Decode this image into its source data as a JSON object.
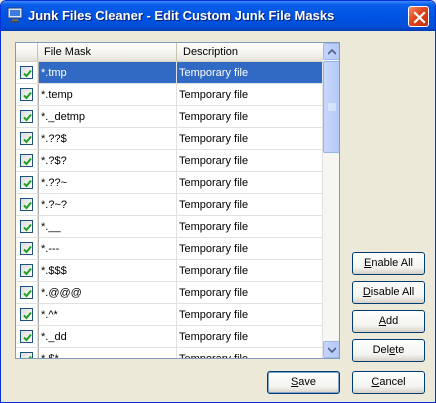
{
  "window": {
    "title": "Junk Files Cleaner - Edit Custom Junk File Masks"
  },
  "grid": {
    "columns": [
      "File Mask",
      "Description"
    ],
    "rows": [
      {
        "checked": true,
        "mask": "*.tmp",
        "description": "Temporary file",
        "selected": true
      },
      {
        "checked": true,
        "mask": "*.temp",
        "description": "Temporary file"
      },
      {
        "checked": true,
        "mask": "*._detmp",
        "description": "Temporary file"
      },
      {
        "checked": true,
        "mask": "*.??$",
        "description": "Temporary file"
      },
      {
        "checked": true,
        "mask": "*.?$?",
        "description": "Temporary file"
      },
      {
        "checked": true,
        "mask": "*.??~",
        "description": "Temporary file"
      },
      {
        "checked": true,
        "mask": "*.?~?",
        "description": "Temporary file"
      },
      {
        "checked": true,
        "mask": "*.__",
        "description": "Temporary file"
      },
      {
        "checked": true,
        "mask": "*.---",
        "description": "Temporary file"
      },
      {
        "checked": true,
        "mask": "*.$$$",
        "description": "Temporary file"
      },
      {
        "checked": true,
        "mask": "*.@@@",
        "description": "Temporary file"
      },
      {
        "checked": true,
        "mask": "*.^*",
        "description": "Temporary file"
      },
      {
        "checked": true,
        "mask": "*._dd",
        "description": "Temporary file"
      },
      {
        "checked": true,
        "mask": "*.$*",
        "description": "Temporary file"
      }
    ]
  },
  "buttons": {
    "enable_all": {
      "prefix": "",
      "accel": "E",
      "rest": "nable All"
    },
    "disable_all": {
      "prefix": "",
      "accel": "D",
      "rest": "isable All"
    },
    "add": {
      "prefix": "",
      "accel": "A",
      "rest": "dd"
    },
    "delete": {
      "prefix": "Del",
      "accel": "e",
      "rest": "te"
    },
    "save": {
      "prefix": "",
      "accel": "S",
      "rest": "ave"
    },
    "cancel": {
      "prefix": "",
      "accel": "C",
      "rest": "ancel"
    }
  },
  "icons": {
    "app": "monitor-cleaner-icon",
    "close": "close-icon",
    "check": "checkmark-icon",
    "scroll_up": "arrow-up-icon",
    "scroll_down": "arrow-down-icon",
    "thumb": "grip-icon"
  },
  "colors": {
    "title_bar": "#0054e3",
    "selection": "#316ac5",
    "check_mark": "#21a121",
    "close_button": "#e0451c"
  }
}
